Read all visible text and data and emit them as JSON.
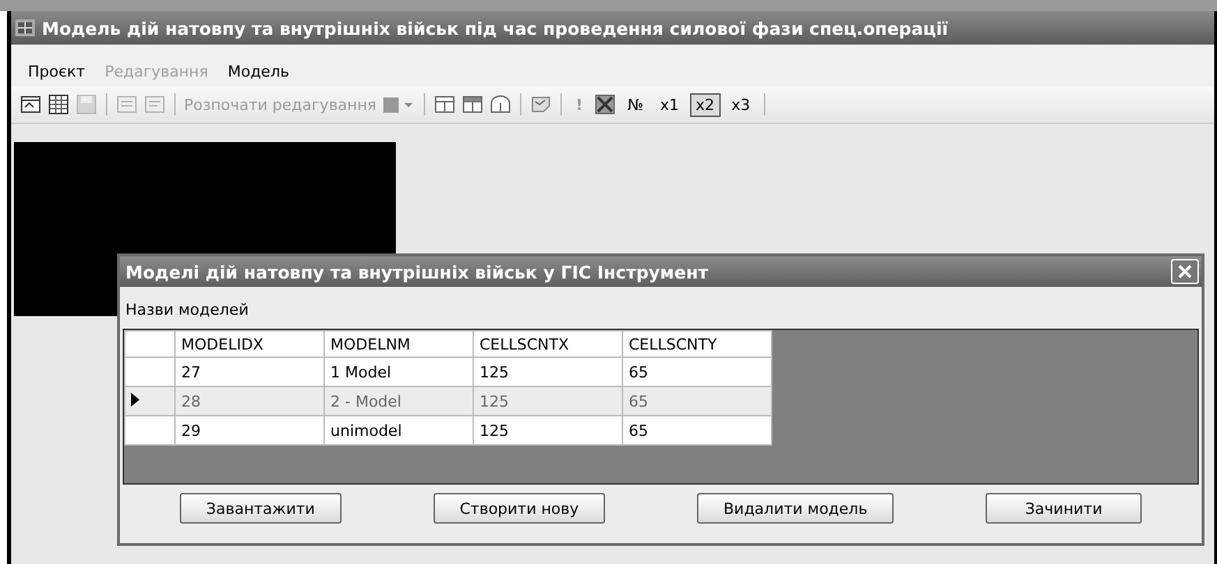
{
  "window": {
    "title": "Модель дій натовпу та внутрішніх військ під час проведення силової фази спец.операції"
  },
  "menu": [
    {
      "label": "Проєкт",
      "disabled": false
    },
    {
      "label": "Редагування",
      "disabled": true
    },
    {
      "label": "Модель",
      "disabled": false
    }
  ],
  "toolbar": {
    "edit_label": "Розпочати редагування",
    "edit_disabled": true,
    "exclamation": "!",
    "number_sign": "№",
    "speeds": [
      {
        "label": "x1",
        "selected": false
      },
      {
        "label": "x2",
        "selected": true
      },
      {
        "label": "x3",
        "selected": false
      }
    ]
  },
  "dialog": {
    "title": "Моделі дій натовпу та внутрішніх військ у ГІС Інструмент",
    "label": "Назви моделей",
    "table": {
      "columns": [
        "MODELIDX",
        "MODELNM",
        "CELLSCNTX",
        "CELLSCNTY"
      ],
      "rows": [
        {
          "cells": [
            "27",
            "1 Model",
            "125",
            "65"
          ],
          "selected": false
        },
        {
          "cells": [
            "28",
            "2 - Model",
            "125",
            "65"
          ],
          "selected": true
        },
        {
          "cells": [
            "29",
            "unimodel",
            "125",
            "65"
          ],
          "selected": false
        }
      ]
    },
    "buttons": [
      "Завантажити",
      "Створити нову",
      "Видалити модель",
      "Зачинити"
    ]
  }
}
